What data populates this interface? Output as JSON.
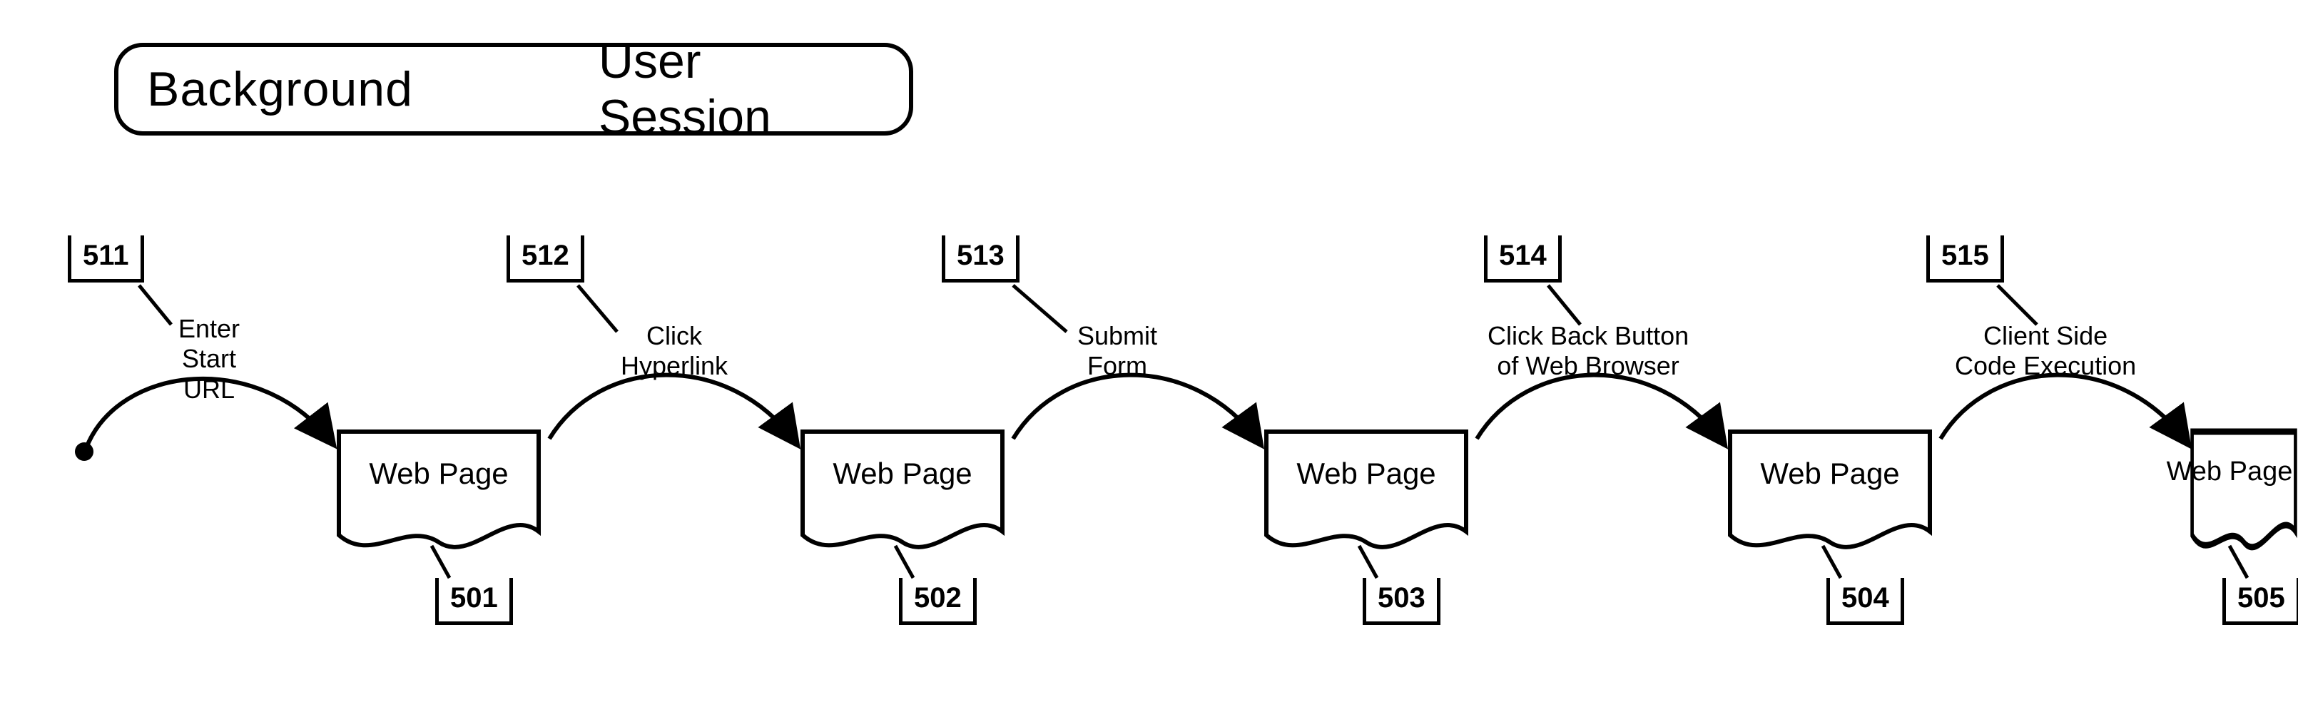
{
  "title": {
    "left": "Background",
    "right": "User Session"
  },
  "pages": [
    {
      "label": "Web Page",
      "ref": "501"
    },
    {
      "label": "Web Page",
      "ref": "502"
    },
    {
      "label": "Web Page",
      "ref": "503"
    },
    {
      "label": "Web Page",
      "ref": "504"
    },
    {
      "label": "Web Page",
      "ref": "505"
    }
  ],
  "actions": [
    {
      "ref": "511",
      "lines": [
        "Enter",
        "Start",
        "URL"
      ]
    },
    {
      "ref": "512",
      "lines": [
        "Click",
        "Hyperlink"
      ]
    },
    {
      "ref": "513",
      "lines": [
        "Submit",
        "Form"
      ]
    },
    {
      "ref": "514",
      "lines": [
        "Click Back Button",
        "of Web Browser"
      ]
    },
    {
      "ref": "515",
      "lines": [
        "Client Side",
        "Code Execution"
      ]
    }
  ]
}
